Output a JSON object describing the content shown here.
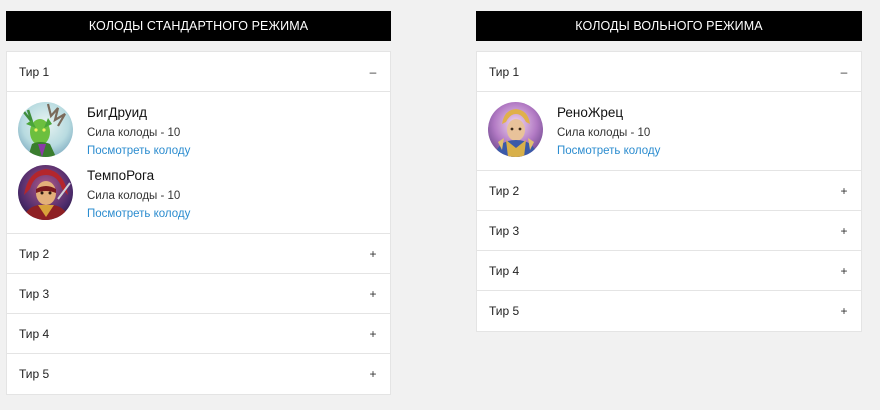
{
  "standard": {
    "title": "КОЛОДЫ СТАНДАРТНОГО РЕЖИМА",
    "tier1": {
      "label": "Тир 1",
      "toggle": "–",
      "decks": [
        {
          "name": "БигДруид",
          "power": "Сила колоды - 10",
          "link": "Посмотреть колоду",
          "avatar": "druid-avatar"
        },
        {
          "name": "ТемпоРога",
          "power": "Сила колоды - 10",
          "link": "Посмотреть колоду",
          "avatar": "rogue-avatar"
        }
      ]
    },
    "tiers": [
      {
        "label": "Тир 2",
        "toggle": "+"
      },
      {
        "label": "Тир 3",
        "toggle": "+"
      },
      {
        "label": "Тир 4",
        "toggle": "+"
      },
      {
        "label": "Тир 5",
        "toggle": "+"
      }
    ]
  },
  "wild": {
    "title": "КОЛОДЫ ВОЛЬНОГО РЕЖИМА",
    "tier1": {
      "label": "Тир 1",
      "toggle": "–",
      "decks": [
        {
          "name": "РеноЖрец",
          "power": "Сила колоды - 10",
          "link": "Посмотреть колоду",
          "avatar": "priest-avatar"
        }
      ]
    },
    "tiers": [
      {
        "label": "Тир 2",
        "toggle": "+"
      },
      {
        "label": "Тир 3",
        "toggle": "+"
      },
      {
        "label": "Тир 4",
        "toggle": "+"
      },
      {
        "label": "Тир 5",
        "toggle": "+"
      }
    ]
  },
  "colors": {
    "header_bg": "#000000",
    "link": "#2b8ccf",
    "page_bg": "#f1f1f1"
  }
}
